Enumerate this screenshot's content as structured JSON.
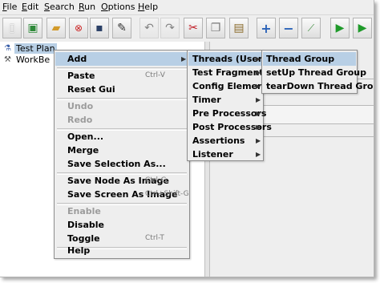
{
  "menubar": [
    {
      "label": "File",
      "mnemonic": "F",
      "rest": "ile"
    },
    {
      "label": "Edit",
      "mnemonic": "E",
      "rest": "dit"
    },
    {
      "label": "Search",
      "mnemonic": "S",
      "rest": "earch"
    },
    {
      "label": "Run",
      "mnemonic": "R",
      "rest": "un"
    },
    {
      "label": "Options",
      "mnemonic": "O",
      "rest": "ptions"
    },
    {
      "label": "Help",
      "mnemonic": "H",
      "rest": "elp"
    }
  ],
  "tree": {
    "test_plan": "Test Plan",
    "workbench": "WorkBe"
  },
  "context_menu": {
    "add": "Add",
    "paste": "Paste",
    "paste_accel": "Ctrl-V",
    "reset_gui": "Reset Gui",
    "undo": "Undo",
    "redo": "Redo",
    "open": "Open...",
    "merge": "Merge",
    "save_selection": "Save Selection As...",
    "save_node_image": "Save Node As Image",
    "save_node_image_accel": "Ctrl-G",
    "save_screen_image": "Save Screen As Image",
    "save_screen_image_accel": "Ctrl+Shift-G",
    "enable": "Enable",
    "disable": "Disable",
    "toggle": "Toggle",
    "toggle_accel": "Ctrl-T",
    "help": "Help"
  },
  "add_submenu": {
    "threads": "Threads (Users)",
    "test_fragment": "Test Fragment",
    "config_element": "Config Element",
    "timer": "Timer",
    "pre_processors": "Pre Processors",
    "post_processors": "Post Processors",
    "assertions": "Assertions",
    "listener": "Listener"
  },
  "threads_submenu": {
    "thread_group": "Thread Group",
    "setup_thread_group": "setUp Thread Group",
    "teardown_thread_group": "tearDown Thread Group"
  }
}
